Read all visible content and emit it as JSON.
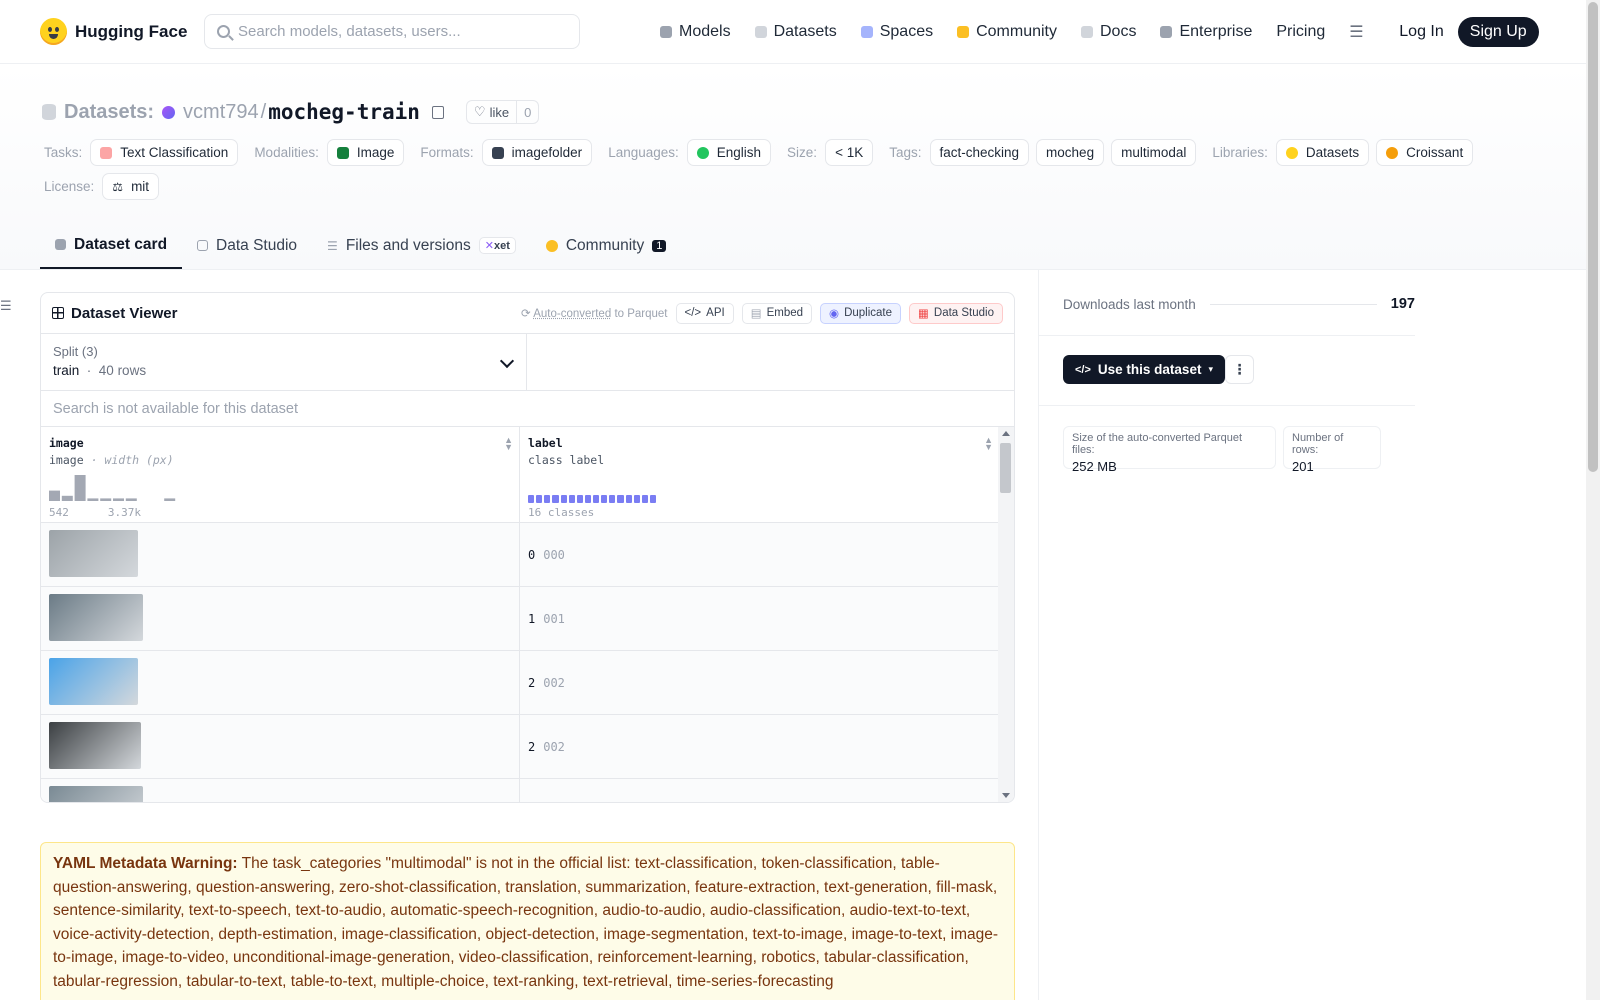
{
  "nav": {
    "brand": "Hugging Face",
    "search_placeholder": "Search models, datasets, users...",
    "links": [
      {
        "label": "Models",
        "icon": "cube-icon",
        "color": "#9ca3af"
      },
      {
        "label": "Datasets",
        "icon": "database-icon",
        "color": "#d1d5db"
      },
      {
        "label": "Spaces",
        "icon": "spaces-icon",
        "color": "#a5b4fc"
      },
      {
        "label": "Community",
        "icon": "community-icon",
        "color": "#fbbf24"
      },
      {
        "label": "Docs",
        "icon": "book-icon",
        "color": "#d1d5db"
      },
      {
        "label": "Enterprise",
        "icon": "enterprise-icon",
        "color": "#9ca3af"
      },
      {
        "label": "Pricing"
      }
    ],
    "login": "Log In",
    "signup": "Sign Up"
  },
  "header": {
    "section": "Datasets:",
    "owner": "vcmt794",
    "slash": "/",
    "repo": "mocheg-train",
    "like_label": "like",
    "like_count": "0"
  },
  "tags": {
    "tasks_label": "Tasks:",
    "tasks": [
      "Text Classification"
    ],
    "modalities_label": "Modalities:",
    "modalities": [
      "Image"
    ],
    "formats_label": "Formats:",
    "formats": [
      "imagefolder"
    ],
    "languages_label": "Languages:",
    "languages": [
      "English"
    ],
    "size_label": "Size:",
    "size": "< 1K",
    "tags_label": "Tags:",
    "tags": [
      "fact-checking",
      "mocheg",
      "multimodal"
    ],
    "libraries_label": "Libraries:",
    "libraries": [
      "Datasets",
      "Croissant"
    ],
    "license_label": "License:",
    "license": "mit"
  },
  "tabs": [
    {
      "label": "Dataset card",
      "active": true
    },
    {
      "label": "Data Studio"
    },
    {
      "label": "Files and versions",
      "badge": "xet"
    },
    {
      "label": "Community",
      "badge": "1"
    }
  ],
  "viewer": {
    "title": "Dataset Viewer",
    "auto_converted": "Auto-converted",
    "to_parquet": "to Parquet",
    "buttons": [
      "API",
      "Embed",
      "Duplicate",
      "Data Studio"
    ],
    "split_label": "Split (3)",
    "split_name": "train",
    "split_rows": "40 rows",
    "search_placeholder": "Search is not available for this dataset",
    "columns": [
      {
        "name": "image",
        "type": "image",
        "type_extra": "width (px)",
        "hist_min": "542",
        "hist_max": "3.37k",
        "hist_values": [
          4,
          2,
          10,
          1,
          1,
          1,
          1,
          0,
          0,
          1
        ]
      },
      {
        "name": "label",
        "type": "class label",
        "classes": "16 classes",
        "class_count": 16
      }
    ],
    "rows": [
      {
        "label_id": "0",
        "label_name": "000",
        "thumb_color": "#9ca3a8",
        "thumb_w": 89
      },
      {
        "label_id": "1",
        "label_name": "001",
        "thumb_color": "#6b7b86",
        "thumb_w": 94
      },
      {
        "label_id": "2",
        "label_name": "002",
        "thumb_color": "#4aa3e8",
        "thumb_w": 89
      },
      {
        "label_id": "2",
        "label_name": "002",
        "thumb_color": "#3b3f42",
        "thumb_w": 92
      },
      {
        "label_id": "",
        "label_name": "",
        "thumb_color": "#7a8a94",
        "thumb_w": 94
      }
    ]
  },
  "warning": {
    "title": "YAML Metadata Warning:",
    "text": "The task_categories \"multimodal\" is not in the official list: text-classification, token-classification, table-question-answering, question-answering, zero-shot-classification, translation, summarization, feature-extraction, text-generation, fill-mask, sentence-similarity, text-to-speech, text-to-audio, automatic-speech-recognition, audio-to-audio, audio-classification, audio-text-to-text, voice-activity-detection, depth-estimation, image-classification, object-detection, image-segmentation, text-to-image, image-to-text, image-to-image, image-to-video, unconditional-image-generation, video-classification, reinforcement-learning, robotics, tabular-classification, tabular-regression, tabular-to-text, table-to-text, multiple-choice, text-ranking, text-retrieval, time-series-forecasting"
  },
  "sidebar": {
    "downloads_label": "Downloads last month",
    "downloads": "197",
    "use_button": "Use this dataset",
    "parquet_label": "Size of the auto-converted Parquet files:",
    "parquet_value": "252 MB",
    "rows_label": "Number of rows:",
    "rows_value": "201"
  }
}
